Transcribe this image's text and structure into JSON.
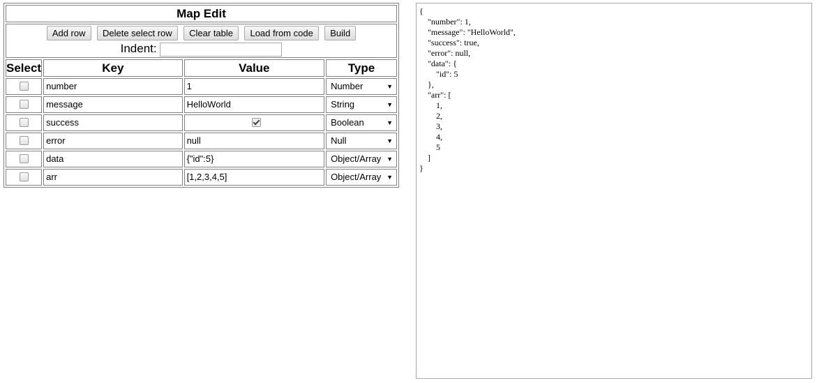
{
  "editor": {
    "title": "Map Edit",
    "buttons": {
      "add_row": "Add row",
      "delete_select_row": "Delete select row",
      "clear_table": "Clear table",
      "load_from_code": "Load from code",
      "build": "Build"
    },
    "indent_label": "Indent:",
    "indent_value": "",
    "columns": {
      "select": "Select",
      "key": "Key",
      "value": "Value",
      "type": "Type"
    },
    "rows": [
      {
        "selected": false,
        "key": "number",
        "value": "1",
        "type": "Number"
      },
      {
        "selected": false,
        "key": "message",
        "value": "HelloWorld",
        "type": "String"
      },
      {
        "selected": false,
        "key": "success",
        "value": true,
        "type": "Boolean"
      },
      {
        "selected": false,
        "key": "error",
        "value": "null",
        "type": "Null"
      },
      {
        "selected": false,
        "key": "data",
        "value": "{\"id\":5}",
        "type": "Object/Array"
      },
      {
        "selected": false,
        "key": "arr",
        "value": "[1,2,3,4,5]",
        "type": "Object/Array"
      }
    ]
  },
  "output": {
    "text": "{\n    \"number\": 1,\n    \"message\": \"HelloWorld\",\n    \"success\": true,\n    \"error\": null,\n    \"data\": {\n        \"id\": 5\n    },\n    \"arr\": [\n        1,\n        2,\n        3,\n        4,\n        5\n    ]\n}"
  }
}
